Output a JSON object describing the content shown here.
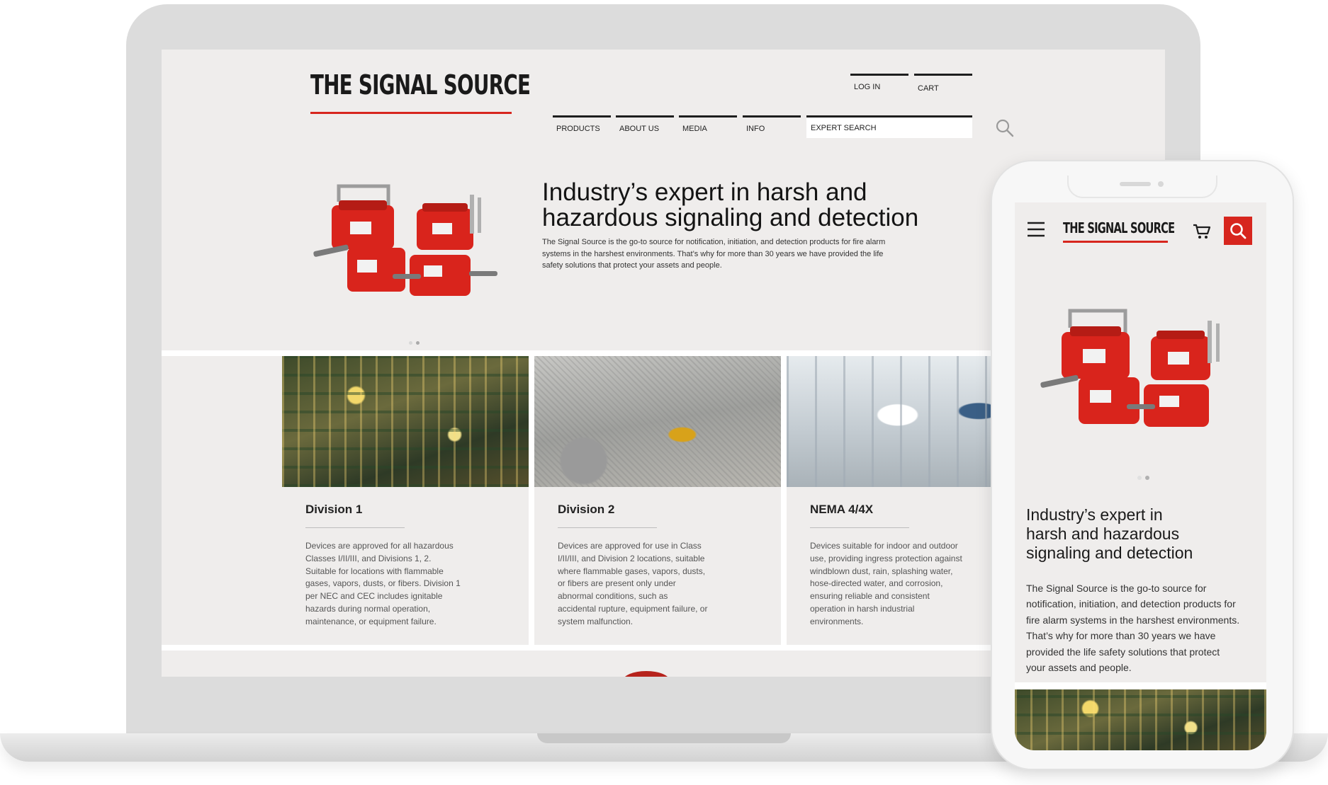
{
  "brand": {
    "logo": "THE SIGNAL SOURCE",
    "accent_color": "#d7261e"
  },
  "desktop": {
    "utility_nav": [
      {
        "label": "LOG IN"
      },
      {
        "label": "CART"
      }
    ],
    "main_nav": [
      {
        "label": "PRODUCTS"
      },
      {
        "label": "ABOUT US"
      },
      {
        "label": "MEDIA"
      },
      {
        "label": "INFO"
      }
    ],
    "search": {
      "placeholder": "EXPERT SEARCH",
      "icon": "search-icon"
    },
    "hero": {
      "title_line1": "Industry’s expert in harsh and",
      "title_line2": "hazardous signaling and detection",
      "body_line1": "The Signal Source is the go-to source for notification, initiation, and detection products for fire alarm",
      "body_line2": "systems in the harshest environments. That’s why for more than 30 years we have provided the life",
      "body_line3": "safety solutions that protect your assets and people.",
      "slides": 2,
      "active_slide": 1
    },
    "cards": [
      {
        "title": "Division 1",
        "body_lines": [
          "Devices are approved for all hazardous",
          "Classes I/II/III, and Divisions 1, 2.",
          "Suitable for locations with flammable",
          "gases, vapors, dusts, or fibers. Division 1",
          "per NEC and CEC includes ignitable",
          "hazards during normal operation,",
          "maintenance, or equipment failure."
        ]
      },
      {
        "title": "Division 2",
        "body_lines": [
          "Devices are approved for use in Class",
          "I/II/III, and Division 2 locations, suitable",
          "where flammable gases, vapors, dusts,",
          "or fibers are present only under",
          "abnormal conditions, such as",
          "accidental rupture, equipment failure, or",
          "system malfunction."
        ]
      },
      {
        "title": "NEMA 4/4X",
        "body_lines": [
          "Devices suitable for indoor and outdoor",
          "use, providing ingress protection against",
          "windblown dust, rain, splashing water,",
          "hose-directed water, and corrosion,",
          "ensuring reliable and consistent",
          "operation in harsh industrial",
          "environments."
        ]
      }
    ]
  },
  "mobile": {
    "menu_icon": "hamburger-icon",
    "cart_icon": "cart-icon",
    "search_icon": "search-icon",
    "hero_title_lines": [
      "Industry’s expert in",
      "harsh and hazardous",
      "signaling and detection"
    ],
    "hero_body_lines": [
      "The Signal Source is the go-to source for",
      "notification, initiation, and detection products for",
      "fire alarm systems in the harshest environments.",
      "That’s why for more than 30 years we have",
      "provided the life safety solutions that protect",
      "your assets and people."
    ],
    "slides": 2,
    "active_slide": 1
  }
}
